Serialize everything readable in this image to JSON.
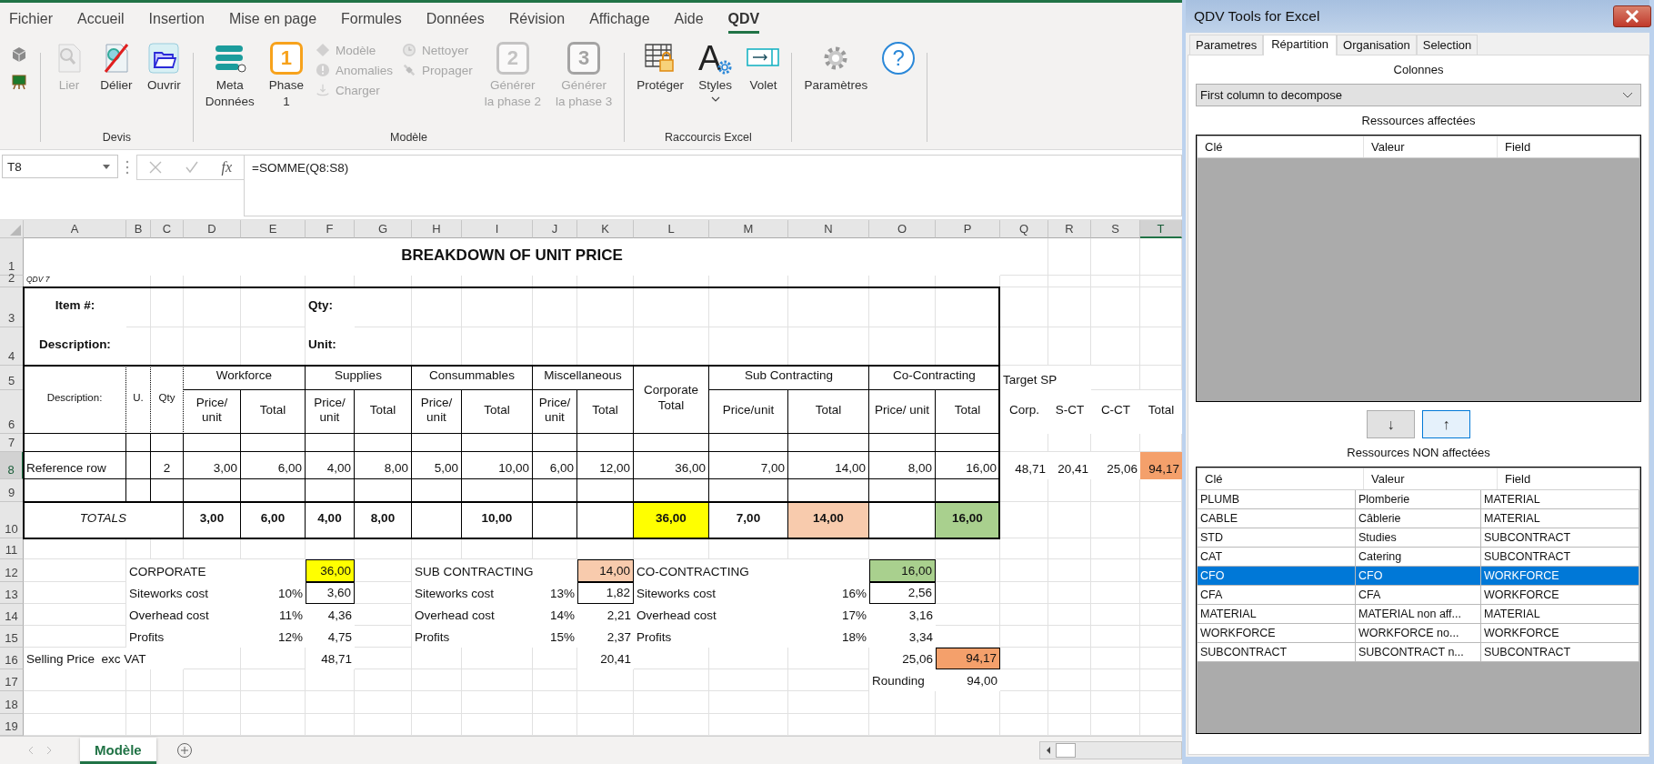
{
  "excel": {
    "ribbon": {
      "tabs": [
        {
          "label": "Fichier",
          "selected": false
        },
        {
          "label": "Accueil",
          "selected": false
        },
        {
          "label": "Insertion",
          "selected": false
        },
        {
          "label": "Mise en page",
          "selected": false
        },
        {
          "label": "Formules",
          "selected": false
        },
        {
          "label": "Données",
          "selected": false
        },
        {
          "label": "Révision",
          "selected": false
        },
        {
          "label": "Affichage",
          "selected": false
        },
        {
          "label": "Aide",
          "selected": false
        },
        {
          "label": "QDV",
          "selected": true
        }
      ],
      "groups": [
        {
          "items": [
            {
              "kind": "stack",
              "items": [
                {
                  "disabled": false
                },
                {
                  "disabled": false
                }
              ]
            }
          ]
        },
        {
          "label": "Devis",
          "items": [
            {
              "kind": "large",
              "label": "Lier",
              "disabled": true
            },
            {
              "kind": "large",
              "label": "Délier",
              "disabled": false
            },
            {
              "kind": "large",
              "label": "Ouvrir",
              "disabled": false
            }
          ]
        },
        {
          "label": "Modèle",
          "items": [
            {
              "kind": "large",
              "label": "Meta\nDonnées",
              "disabled": false
            },
            {
              "kind": "large",
              "label": "Phase\n1",
              "badge": "1",
              "disabled": false
            },
            {
              "kind": "stack",
              "items": [
                {
                  "label": "Modèle",
                  "disabled": true
                },
                {
                  "label": "Anomalies",
                  "disabled": true
                },
                {
                  "label": "Charger",
                  "disabled": true
                }
              ]
            },
            {
              "kind": "stack",
              "items": [
                {
                  "label": "Nettoyer",
                  "disabled": true
                },
                {
                  "label": "Propager",
                  "disabled": true
                }
              ]
            },
            {
              "kind": "large",
              "label": "Générer\nla phase 2",
              "badge": "2",
              "disabled": true
            },
            {
              "kind": "large",
              "label": "Générer\nla phase 3",
              "badge": "3",
              "disabled": true
            }
          ]
        },
        {
          "label": "Raccourcis Excel",
          "items": [
            {
              "kind": "large",
              "label": "Protéger",
              "disabled": false
            },
            {
              "kind": "large",
              "label": "Styles",
              "badge": "A",
              "menu": true,
              "disabled": false
            },
            {
              "kind": "large",
              "label": "Volet",
              "disabled": false
            }
          ]
        },
        {
          "items": [
            {
              "kind": "large",
              "label": "Paramètres",
              "disabled": false
            },
            {
              "kind": "large",
              "badge": "?",
              "disabled": false
            }
          ]
        }
      ]
    },
    "formula_bar": {
      "name_box": "T8",
      "function_label": "fx",
      "formula": "=SOMME(Q8:S8)"
    },
    "sheet": {
      "columns": [
        {
          "label": "A",
          "selected": false
        },
        {
          "label": "B",
          "selected": false
        },
        {
          "label": "C",
          "selected": false
        },
        {
          "label": "D",
          "selected": false
        },
        {
          "label": "E",
          "selected": false
        },
        {
          "label": "F",
          "selected": false
        },
        {
          "label": "G",
          "selected": false
        },
        {
          "label": "H",
          "selected": false
        },
        {
          "label": "I",
          "selected": false
        },
        {
          "label": "J",
          "selected": false
        },
        {
          "label": "K",
          "selected": false
        },
        {
          "label": "L",
          "selected": false
        },
        {
          "label": "M",
          "selected": false
        },
        {
          "label": "N",
          "selected": false
        },
        {
          "label": "O",
          "selected": false
        },
        {
          "label": "P",
          "selected": false
        },
        {
          "label": "Q",
          "selected": false
        },
        {
          "label": "R",
          "selected": false
        },
        {
          "label": "S",
          "selected": false
        },
        {
          "label": "T",
          "selected": true
        }
      ],
      "rows": [
        {
          "n": "1",
          "selected": false,
          "cells": [
            {
              "text": "BREAKDOWN OF UNIT PRICE",
              "kind": "title"
            }
          ]
        },
        {
          "n": "2",
          "selected": false,
          "cells": [
            {
              "text": "QDV 7",
              "kind": "note"
            }
          ]
        },
        {
          "n": "3",
          "selected": false,
          "cells": [
            {
              "text": "Item #:",
              "kind": "caption"
            },
            {
              "text": "Qty:",
              "kind": "label"
            }
          ]
        },
        {
          "n": "4",
          "selected": false,
          "cells": [
            {
              "text": "Description:",
              "kind": "caption"
            },
            {
              "text": "Unit:",
              "kind": "label"
            }
          ]
        },
        {
          "n": "5",
          "selected": false,
          "cells": [
            {
              "text": "Description:",
              "kind": "subhead"
            },
            {
              "text": "U.",
              "kind": "subhead"
            },
            {
              "text": "Qty",
              "kind": "subhead"
            },
            {
              "text": "Workforce",
              "kind": "head"
            },
            {
              "text": "Supplies",
              "kind": "head"
            },
            {
              "text": "Consummables",
              "kind": "head"
            },
            {
              "text": "Miscellaneous",
              "kind": "head"
            },
            {
              "text": "Corporate Total",
              "kind": "head"
            },
            {
              "text": "Sub Contracting",
              "kind": "head"
            },
            {
              "text": "Co-Contracting",
              "kind": "head"
            },
            {
              "text": "Target SP",
              "kind": "plain"
            }
          ]
        },
        {
          "n": "6",
          "selected": false,
          "cells": [
            {
              "text": "Price/ unit",
              "kind": "head"
            },
            {
              "text": "Total",
              "kind": "head"
            },
            {
              "text": "Price/ unit",
              "kind": "head"
            },
            {
              "text": "Total",
              "kind": "head"
            },
            {
              "text": "Price/ unit",
              "kind": "head"
            },
            {
              "text": "Total",
              "kind": "head"
            },
            {
              "text": "Price/ unit",
              "kind": "head"
            },
            {
              "text": "Total",
              "kind": "head"
            },
            {
              "text": "Price/unit",
              "kind": "head"
            },
            {
              "text": "Total",
              "kind": "head"
            },
            {
              "text": "Price/ unit",
              "kind": "head"
            },
            {
              "text": "Total",
              "kind": "head"
            },
            {
              "text": "Corp.",
              "kind": "pmid"
            },
            {
              "text": "S-CT",
              "kind": "pmid"
            },
            {
              "text": "C-CT",
              "kind": "pmid"
            },
            {
              "text": "Total",
              "kind": "pmid"
            }
          ]
        },
        {
          "n": "7",
          "selected": false,
          "cells": [
            {
              "kind": "cell"
            },
            {
              "kind": "cell"
            },
            {
              "kind": "cell"
            },
            {
              "kind": "cell"
            },
            {
              "kind": "cell"
            },
            {
              "kind": "cell"
            },
            {
              "kind": "cell"
            },
            {
              "kind": "cell"
            },
            {
              "kind": "cell"
            },
            {
              "kind": "cell"
            },
            {
              "kind": "cell"
            },
            {
              "kind": "cell"
            },
            {
              "kind": "cell"
            },
            {
              "kind": "cell"
            },
            {
              "kind": "cell"
            },
            {
              "kind": "cell"
            }
          ]
        },
        {
          "n": "8",
          "selected": true,
          "cells": [
            {
              "text": "Reference row",
              "kind": "cell"
            },
            {
              "kind": "cell"
            },
            {
              "text": "2",
              "kind": "center"
            },
            {
              "text": "3,00",
              "kind": "num"
            },
            {
              "text": "6,00",
              "kind": "num"
            },
            {
              "text": "4,00",
              "kind": "num"
            },
            {
              "text": "8,00",
              "kind": "num"
            },
            {
              "text": "5,00",
              "kind": "num"
            },
            {
              "text": "10,00",
              "kind": "num"
            },
            {
              "text": "6,00",
              "kind": "num"
            },
            {
              "text": "12,00",
              "kind": "num"
            },
            {
              "text": "36,00",
              "kind": "num"
            },
            {
              "text": "7,00",
              "kind": "num"
            },
            {
              "text": "14,00",
              "kind": "num"
            },
            {
              "text": "8,00",
              "kind": "num"
            },
            {
              "text": "16,00",
              "kind": "num"
            },
            {
              "text": "48,71",
              "kind": "pnum"
            },
            {
              "text": "20,41",
              "kind": "pnum"
            },
            {
              "text": "25,06",
              "kind": "pnum"
            },
            {
              "text": "94,17",
              "kind": "pnum",
              "color": "#f4a06b"
            }
          ]
        },
        {
          "n": "9",
          "selected": false,
          "cells": [
            {
              "kind": "cell"
            },
            {
              "kind": "cell"
            },
            {
              "kind": "cell"
            },
            {
              "kind": "cell"
            },
            {
              "kind": "cell"
            },
            {
              "kind": "cell"
            },
            {
              "kind": "cell"
            },
            {
              "kind": "cell"
            },
            {
              "kind": "cell"
            },
            {
              "kind": "cell"
            },
            {
              "kind": "cell"
            },
            {
              "kind": "cell"
            },
            {
              "kind": "cell"
            },
            {
              "kind": "cell"
            },
            {
              "kind": "cell"
            },
            {
              "kind": "cell"
            }
          ]
        },
        {
          "n": "10",
          "selected": false,
          "cells": [
            {
              "text": "TOTALS",
              "kind": "totlabel"
            },
            {
              "text": "3,00",
              "kind": "total"
            },
            {
              "text": "6,00",
              "kind": "total"
            },
            {
              "text": "4,00",
              "kind": "total"
            },
            {
              "text": "8,00",
              "kind": "total"
            },
            {
              "kind": "total"
            },
            {
              "text": "10,00",
              "kind": "total"
            },
            {
              "kind": "total"
            },
            {
              "kind": "total"
            },
            {
              "text": "36,00",
              "kind": "total",
              "color": "#ffff00"
            },
            {
              "text": "7,00",
              "kind": "total"
            },
            {
              "text": "14,00",
              "kind": "total",
              "color": "#f8cbad"
            },
            {
              "kind": "total"
            },
            {
              "text": "16,00",
              "kind": "total",
              "color": "#a9d08e"
            }
          ]
        },
        {
          "n": "11",
          "selected": false
        },
        {
          "n": "12",
          "selected": false,
          "cells": [
            {
              "text": "CORPORATE",
              "kind": "plain"
            },
            {
              "text": "36,00",
              "kind": "box",
              "color": "#ffff00"
            },
            {
              "text": "SUB CONTRACTING",
              "kind": "plain"
            },
            {
              "text": "14,00",
              "kind": "box",
              "color": "#f8cbad"
            },
            {
              "text": "CO-CONTRACTING",
              "kind": "plain"
            },
            {
              "text": "16,00",
              "kind": "box",
              "color": "#a9d08e"
            }
          ]
        },
        {
          "n": "13",
          "selected": false,
          "cells": [
            {
              "text": "Siteworks cost",
              "kind": "plain"
            },
            {
              "text": "10%",
              "kind": "pnum"
            },
            {
              "text": "3,60",
              "kind": "box"
            },
            {
              "text": "Siteworks cost",
              "kind": "plain"
            },
            {
              "text": "13%",
              "kind": "pnum"
            },
            {
              "text": "1,82",
              "kind": "box"
            },
            {
              "text": "Siteworks cost",
              "kind": "plain"
            },
            {
              "text": "16%",
              "kind": "pnum"
            },
            {
              "text": "2,56",
              "kind": "box"
            }
          ]
        },
        {
          "n": "14",
          "selected": false,
          "cells": [
            {
              "text": "Overhead cost",
              "kind": "plain"
            },
            {
              "text": "11%",
              "kind": "pnum"
            },
            {
              "text": "4,36",
              "kind": "pnum"
            },
            {
              "text": "Overhead cost",
              "kind": "plain"
            },
            {
              "text": "14%",
              "kind": "pnum"
            },
            {
              "text": "2,21",
              "kind": "pnum"
            },
            {
              "text": "Overhead cost",
              "kind": "plain"
            },
            {
              "text": "17%",
              "kind": "pnum"
            },
            {
              "text": "3,16",
              "kind": "pnum"
            }
          ]
        },
        {
          "n": "15",
          "selected": false,
          "cells": [
            {
              "text": "Profits",
              "kind": "plain"
            },
            {
              "text": "12%",
              "kind": "pnum"
            },
            {
              "text": "4,75",
              "kind": "pnum"
            },
            {
              "text": "Profits",
              "kind": "plain"
            },
            {
              "text": "15%",
              "kind": "pnum"
            },
            {
              "text": "2,37",
              "kind": "pnum"
            },
            {
              "text": "Profits",
              "kind": "plain"
            },
            {
              "text": "18%",
              "kind": "pnum"
            },
            {
              "text": "3,34",
              "kind": "pnum"
            }
          ]
        },
        {
          "n": "16",
          "selected": false,
          "cells": [
            {
              "text": "Selling Price  exc VAT",
              "kind": "plain"
            },
            {
              "text": "48,71",
              "kind": "pnum"
            },
            {
              "text": "20,41",
              "kind": "pnum"
            },
            {
              "text": "25,06",
              "kind": "pnum"
            },
            {
              "text": "94,17",
              "kind": "box",
              "color": "#f4a06b"
            }
          ]
        },
        {
          "n": "17",
          "selected": false,
          "cells": [
            {
              "text": "Rounding",
              "kind": "plain"
            },
            {
              "text": "94,00",
              "kind": "pnum"
            }
          ]
        },
        {
          "n": "18",
          "selected": false
        },
        {
          "n": "19",
          "selected": false
        }
      ]
    },
    "sheet_tabs": [
      {
        "label": "Modèle",
        "selected": true
      }
    ]
  },
  "panel": {
    "title": "QDV Tools for Excel",
    "tabs": [
      {
        "label": "Parametres",
        "selected": false
      },
      {
        "label": "Répartition",
        "selected": true
      },
      {
        "label": "Organisation",
        "selected": false
      },
      {
        "label": "Selection",
        "selected": false
      }
    ],
    "columns_label": "Colonnes",
    "dropdown": {
      "value": "First column to decompose"
    },
    "assigned": {
      "title": "Ressources affectées",
      "columns": [
        "Clé",
        "Valeur",
        "Field"
      ]
    },
    "buttons": [
      {
        "label": "↓",
        "focused": false
      },
      {
        "label": "↑",
        "focused": true
      }
    ],
    "unassigned": {
      "title": "Ressources NON affectées",
      "columns": [
        "Clé",
        "Valeur",
        "Field"
      ],
      "rows": [
        {
          "cells": [
            "PLUMB",
            "Plomberie",
            "MATERIAL"
          ],
          "selected": false
        },
        {
          "cells": [
            "CABLE",
            "Câblerie",
            "MATERIAL"
          ],
          "selected": false
        },
        {
          "cells": [
            "STD",
            "Studies",
            "SUBCONTRACT"
          ],
          "selected": false
        },
        {
          "cells": [
            "CAT",
            "Catering",
            "SUBCONTRACT"
          ],
          "selected": false
        },
        {
          "cells": [
            "CFO",
            "CFO",
            "WORKFORCE"
          ],
          "selected": true
        },
        {
          "cells": [
            "CFA",
            "CFA",
            "WORKFORCE"
          ],
          "selected": false
        },
        {
          "cells": [
            "MATERIAL",
            "MATERIAL non aff...",
            "MATERIAL"
          ],
          "selected": false
        },
        {
          "cells": [
            "WORKFORCE",
            "WORKFORCE no...",
            "WORKFORCE"
          ],
          "selected": false
        },
        {
          "cells": [
            "SUBCONTRACT",
            "SUBCONTRACT n...",
            "SUBCONTRACT"
          ],
          "selected": false
        }
      ]
    }
  }
}
